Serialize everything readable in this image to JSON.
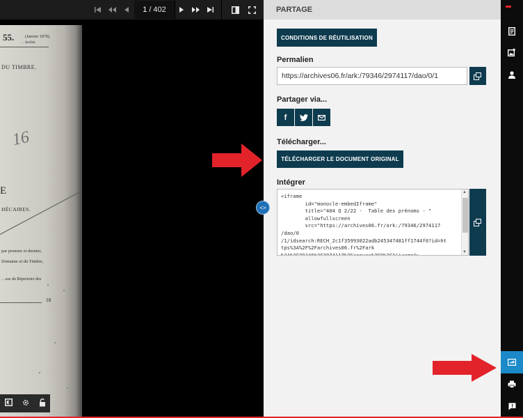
{
  "viewer": {
    "page_current": "1",
    "page_separator": "/",
    "page_total": "402",
    "nav_first": "first-page",
    "nav_prev_fast": "previous-pages",
    "nav_prev": "previous-page",
    "nav_next": "next-page",
    "nav_next_fast": "next-pages",
    "nav_last": "last-page"
  },
  "document_text": {
    "line1": "55.",
    "line1_small": "(Janvier 1879).",
    "line1_sub": "…   feuillet.",
    "line2": "DU TIMBRE.",
    "handwriting": "16",
    "letter": "E",
    "line3": "HÉCAIRES.",
    "line4": "par premier et dernier,",
    "line5": "Domaine et du Timbre,",
    "line6": "…sse du Répertoire des",
    "line7": "18"
  },
  "panel": {
    "title": "PARTAGE",
    "conditions_button": "CONDITIONS DE RÉUTILISATION",
    "permalink_label": "Permalien",
    "permalink_value": "https://archives06.fr/ark:/79346/2974117/dao/0/1",
    "share_label": "Partager via...",
    "download_label": "Télécharger...",
    "download_button": "TÉLÉCHARGER LE DOCUMENT ORIGINAL",
    "embed_label": "Intégrer",
    "embed_code": "<iframe\n        id=\"monocle-embedIframe\"\n        title=\"404 Q 2/22 -  Table des prénoms - \"\n        allowfullscreen\n        src=\"https://archives06.fr/ark:/79346/2974117\n/dao/0\n/1/idsearch:RECH_2c1f35993022adb245347481ff1744f0?id=ht\ntps%3A%2F%2Farchives06.fr%2Fark\n%3A%2F79346%2F2974117%2Fcanvas%2F0%2F1&icame\">"
  },
  "colors": {
    "accent": "#0e3b4e",
    "sidebar_active": "#1c8ac9",
    "arrow_red": "#e3232a"
  },
  "icons": {
    "facebook": "f",
    "twitter": "twitter-bird",
    "email": "envelope"
  }
}
